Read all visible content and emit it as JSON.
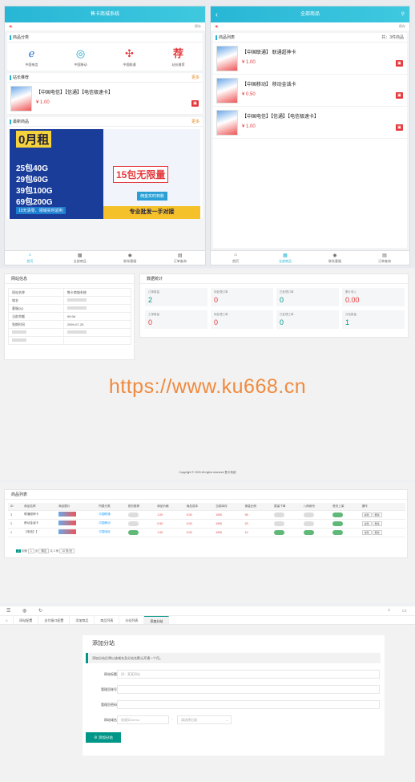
{
  "phone_left": {
    "title": "售卡商城系统",
    "notice_right": "保存",
    "category_title": "商品分类",
    "categories": [
      {
        "label": "中国电信",
        "icon": "telecom-logo"
      },
      {
        "label": "中国移动",
        "icon": "mobile-logo"
      },
      {
        "label": "中国联通",
        "icon": "unicom-logo"
      },
      {
        "label": "站长推荐",
        "icon": "recommend-icon"
      }
    ],
    "recommend_title": "站长推荐",
    "more": "更多",
    "product": {
      "name": "【中国电信】【信通】【电信极速卡】",
      "price": "¥ 1.00"
    },
    "latest_title": "最新商品",
    "banner": {
      "headline": "0月租",
      "rows": [
        "25包40G",
        "29包60G",
        "39包100G",
        "69包200G"
      ],
      "foot": "10天清零、领域实时返利",
      "unlimited": "15包无限量",
      "realtime": "佣金实时到账",
      "bulk": "专业批发一手对接"
    },
    "tabs": [
      "首页",
      "全部商品",
      "联系客服",
      "订单查询"
    ]
  },
  "phone_right": {
    "title": "全部商品",
    "notice_right": "保存",
    "list_title": "商品列表",
    "count": "共：3件商品",
    "products": [
      {
        "name": "【中国联通】 联通超神卡",
        "price": "¥ 1.00"
      },
      {
        "name": "【中国移动】 移动金诚卡",
        "price": "¥ 0.50"
      },
      {
        "name": "【中国电信】【信通】【电信极速卡】",
        "price": "¥ 1.00"
      }
    ],
    "tabs": [
      "首页",
      "全部商品",
      "联系客服",
      "订单查询"
    ]
  },
  "site_info": {
    "title": "网站信息",
    "rows": [
      [
        "网站名称",
        "售卡商城系统"
      ],
      [
        "域名",
        ""
      ],
      [
        "客服QQ",
        ""
      ],
      [
        "当前余额",
        "99.98"
      ],
      [
        "到期时间",
        "2099-07-25"
      ],
      [
        "",
        ""
      ],
      [
        "",
        ""
      ]
    ]
  },
  "stats": {
    "title": "数据统计",
    "items": [
      {
        "label": "订单数量",
        "value": "2",
        "color": "#009688"
      },
      {
        "label": "待处理订单",
        "value": "0",
        "color": "#e4393c"
      },
      {
        "label": "已处理订单",
        "value": "0",
        "color": "#009688"
      },
      {
        "label": "累计收入",
        "value": "0.00",
        "color": "#e4393c"
      },
      {
        "label": "工单数量",
        "value": "0",
        "color": "#e4393c"
      },
      {
        "label": "待处理工单",
        "value": "0",
        "color": "#e4393c"
      },
      {
        "label": "已处理工单",
        "value": "0",
        "color": "#009688"
      },
      {
        "label": "分站数量",
        "value": "1",
        "color": "#009688"
      }
    ]
  },
  "watermark": "https://www.ku668.cn",
  "copyright": "Copyright © 2020  All rights reserved  售卡系统",
  "goods_list": {
    "title": "商品列表",
    "headers": [
      "ID",
      "商品名称",
      "商品图片",
      "所属分类",
      "首页推荐",
      "商品价格",
      "商品成本",
      "当前库存",
      "佣金比例",
      "数量下单",
      "八网身份",
      "首页上架",
      "操作"
    ],
    "rows": [
      [
        "3",
        "联通超神卡",
        "",
        "中国联通",
        "",
        "1.00",
        "0.00",
        "1000",
        "95",
        "",
        "",
        "",
        ""
      ],
      [
        "2",
        "移动金诚卡",
        "",
        "中国移动",
        "",
        "0.50",
        "0.00",
        "1000",
        "20",
        "",
        "",
        "",
        ""
      ],
      [
        "1",
        "【电信】【",
        "",
        "中国电信",
        "",
        "1.00",
        "0.00",
        "1000",
        "10",
        "",
        "",
        "",
        ""
      ]
    ],
    "edit": "编辑",
    "del": "删除",
    "pager": [
      "1",
      "到第",
      "1",
      "页",
      "确定",
      "共 3 条",
      "10 条/页"
    ]
  },
  "admin": {
    "tabs": [
      "网站配置",
      "支付接口配置",
      "添加商品",
      "商品列表",
      "分站列表",
      "添加分站"
    ],
    "form_title": "添加分站",
    "tip": "添加分站后将以该域名及分站名默认开通一个月。",
    "fields": [
      {
        "label": "网站标题",
        "placeholder": "如：某某网站"
      },
      {
        "label": "管理员账号",
        "placeholder": ""
      },
      {
        "label": "管理员密码",
        "placeholder": ""
      },
      {
        "label": "网站域名",
        "placeholder": "前缀如:demo"
      }
    ],
    "domain_select": "请选择后缀",
    "submit": "添加分站"
  }
}
